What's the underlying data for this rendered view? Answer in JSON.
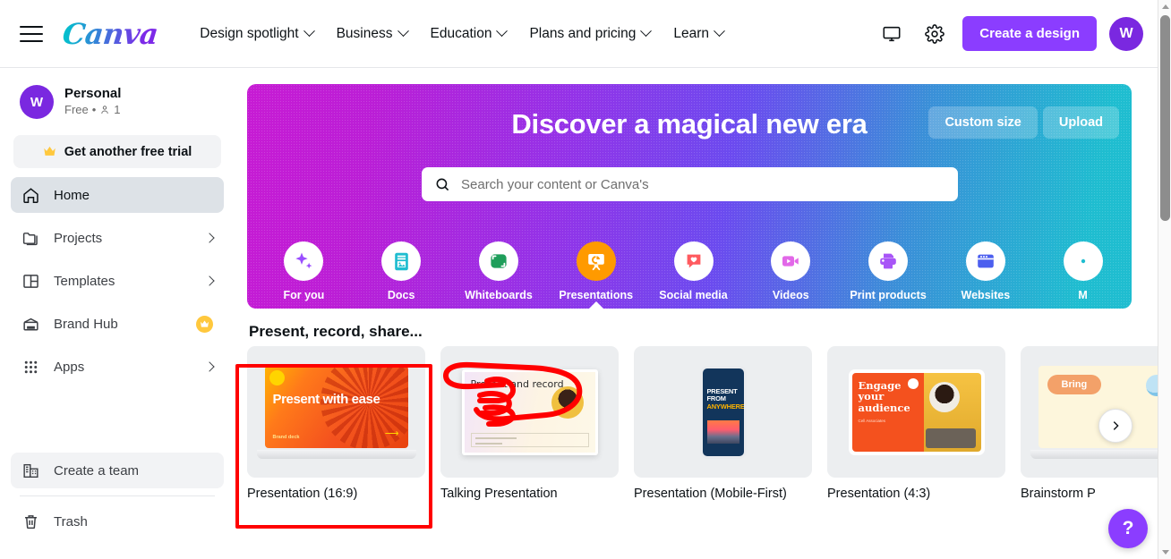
{
  "header": {
    "menu_icon": "hamburger-icon",
    "logo_text": "Canva",
    "nav": [
      {
        "label": "Design spotlight",
        "has_caret": true
      },
      {
        "label": "Business",
        "has_caret": true
      },
      {
        "label": "Education",
        "has_caret": true
      },
      {
        "label": "Plans and pricing",
        "has_caret": true
      },
      {
        "label": "Learn",
        "has_caret": true
      }
    ],
    "display_icon": "monitor-icon",
    "settings_icon": "gear-icon",
    "create_label": "Create a design",
    "avatar_initial": "W"
  },
  "sidebar": {
    "account": {
      "initial": "W",
      "name": "Personal",
      "plan": "Free",
      "members": "1"
    },
    "trial_label": "Get another free trial",
    "items": [
      {
        "label": "Home",
        "icon": "home-icon",
        "active": true,
        "chevron": false,
        "crown": false
      },
      {
        "label": "Projects",
        "icon": "folder-icon",
        "active": false,
        "chevron": true,
        "crown": false
      },
      {
        "label": "Templates",
        "icon": "templates-icon",
        "active": false,
        "chevron": true,
        "crown": false
      },
      {
        "label": "Brand Hub",
        "icon": "brand-hub-icon",
        "active": false,
        "chevron": false,
        "crown": true
      },
      {
        "label": "Apps",
        "icon": "apps-grid-icon",
        "active": false,
        "chevron": true,
        "crown": false
      }
    ],
    "bottom_items": [
      {
        "label": "Create a team",
        "icon": "building-icon",
        "highlight": true
      },
      {
        "label": "Trash",
        "icon": "trash-icon",
        "highlight": false
      }
    ]
  },
  "hero": {
    "title": "Discover a magical new era",
    "custom_size_label": "Custom size",
    "upload_label": "Upload",
    "search_placeholder": "Search your content or Canva's",
    "search_value": "",
    "search_icon": "search-icon",
    "gradient_from": "#c71bd4",
    "gradient_to": "#1fbdd0",
    "active_color": "#ff9a00",
    "categories": [
      {
        "label": "For you",
        "icon": "sparkle-icon",
        "active": false
      },
      {
        "label": "Docs",
        "icon": "document-icon",
        "active": false
      },
      {
        "label": "Whiteboards",
        "icon": "whiteboard-icon",
        "active": false
      },
      {
        "label": "Presentations",
        "icon": "presentation-icon",
        "active": true
      },
      {
        "label": "Social media",
        "icon": "heart-chat-icon",
        "active": false
      },
      {
        "label": "Videos",
        "icon": "video-camera-icon",
        "active": false
      },
      {
        "label": "Print products",
        "icon": "printer-icon",
        "active": false
      },
      {
        "label": "Websites",
        "icon": "browser-window-icon",
        "active": false
      },
      {
        "label": "M",
        "icon": "more-icon",
        "active": false
      }
    ]
  },
  "main": {
    "section_title": "Present, record, share...",
    "cards": [
      {
        "label": "Presentation (16:9)",
        "thumb": "laptop-orange-slide",
        "slide_title": "Present with ease",
        "slide_sub": "Brand deck",
        "selected": true
      },
      {
        "label": "Talking Presentation",
        "thumb": "talking-slide",
        "slide_title": "Present and record",
        "slide_sub": "",
        "selected": false
      },
      {
        "label": "Presentation (Mobile-First)",
        "thumb": "phone-slide",
        "slide_title": "PRESENT FROM ANYWHERE",
        "slide_sub": "",
        "selected": false
      },
      {
        "label": "Presentation (4:3)",
        "thumb": "tablet-slide",
        "slide_title": "Engage your audience",
        "slide_sub": "Cell Associates",
        "selected": false
      },
      {
        "label": "Brainstorm P",
        "thumb": "brainstorm-slide",
        "slide_title": "Bring",
        "slide_sub": "",
        "selected": false
      }
    ],
    "next_arrow_icon": "chevron-right-icon",
    "help_label": "?"
  },
  "annotations": {
    "highlight_color": "#ff0000",
    "pointer_icon": "pointing-hand-icon"
  },
  "scrollbar": {
    "up_icon": "scroll-up-arrow",
    "down_icon": "scroll-down-arrow"
  }
}
